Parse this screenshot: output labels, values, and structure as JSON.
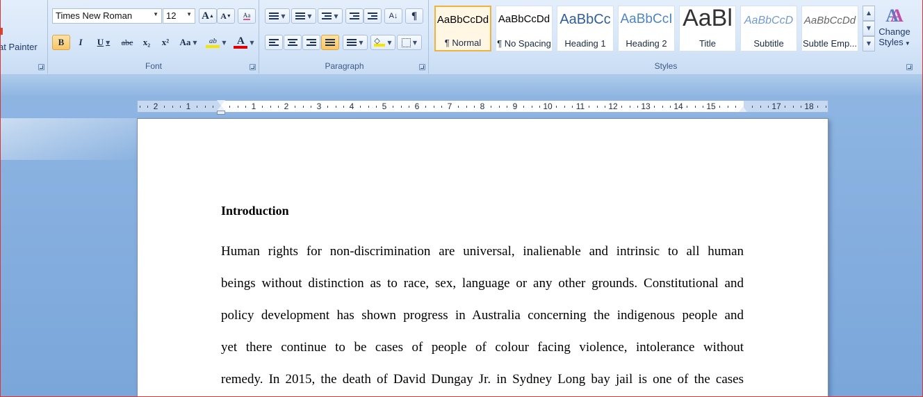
{
  "ribbon": {
    "clipboard": {
      "format_painter_label": "at Painter"
    },
    "font": {
      "group_label": "Font",
      "font_name": "Times New Roman",
      "font_size": "12",
      "grow_label": "A",
      "shrink_label": "A",
      "clear_label": "Aa",
      "bold_label": "B",
      "italic_label": "I",
      "underline_label": "U",
      "strike_label": "abc",
      "subscript_label": "x₂",
      "superscript_label": "x²",
      "case_label": "Aa",
      "highlight_label": "ab",
      "font_color_label": "A",
      "highlight_color": "#f5e600",
      "font_color": "#e00000"
    },
    "paragraph": {
      "group_label": "Paragraph"
    },
    "styles": {
      "group_label": "Styles",
      "change_styles_line1": "Change",
      "change_styles_line2": "Styles",
      "items": [
        {
          "sample": "AaBbCcDd",
          "name": "¶ Normal"
        },
        {
          "sample": "AaBbCcDd",
          "name": "¶ No Spacing"
        },
        {
          "sample": "AaBbCc",
          "name": "Heading 1"
        },
        {
          "sample": "AaBbCcI",
          "name": "Heading 2"
        },
        {
          "sample": "AaBl",
          "name": "Title"
        },
        {
          "sample": "AaBbCcD",
          "name": "Subtitle"
        },
        {
          "sample": "AaBbCcDd",
          "name": "Subtle Emp..."
        }
      ]
    }
  },
  "ruler": {
    "left_numbers": [
      "2",
      "1"
    ],
    "numbers": [
      "1",
      "2",
      "3",
      "4",
      "5",
      "6",
      "7",
      "8",
      "9",
      "10",
      "11",
      "12",
      "13",
      "14",
      "15"
    ],
    "right_numbers": [
      "17",
      "18"
    ]
  },
  "document": {
    "heading": "Introduction",
    "lines": [
      "Human rights for non-discrimination are universal, inalienable and intrinsic to all human",
      "beings without distinction as to race, sex, language or any other grounds. Constitutional and",
      "policy development has shown progress in Australia concerning the indigenous people and",
      "yet there continue to be cases of people of colour facing violence, intolerance without",
      "remedy. In 2015, the death of David Dungay Jr. in Sydney Long bay jail is one of the cases"
    ]
  }
}
